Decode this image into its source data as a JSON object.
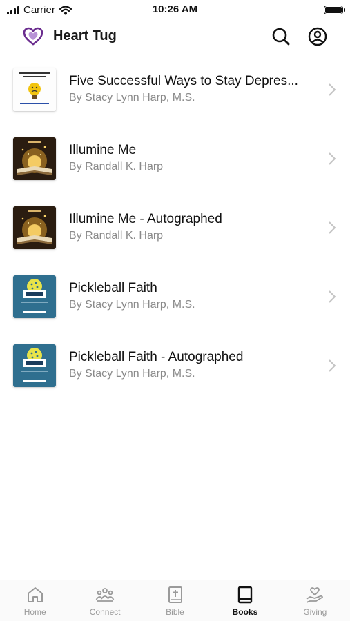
{
  "status_bar": {
    "carrier": "Carrier",
    "time": "10:26 AM"
  },
  "header": {
    "app_title": "Heart Tug",
    "brand_color": "#6b2d8f"
  },
  "books": [
    {
      "title": "Five Successful Ways to Stay Depres...",
      "author": "By Stacy Lynn Harp, M.S.",
      "cover_icon": "emoji-cover"
    },
    {
      "title": "Illumine Me",
      "author": "By Randall K. Harp",
      "cover_icon": "glowing-book-cover"
    },
    {
      "title": "Illumine Me - Autographed",
      "author": "By Randall K. Harp",
      "cover_icon": "glowing-book-cover"
    },
    {
      "title": "Pickleball Faith",
      "author": "By Stacy Lynn Harp, M.S.",
      "cover_icon": "pickleball-cover"
    },
    {
      "title": "Pickleball Faith - Autographed",
      "author": "By Stacy Lynn Harp, M.S.",
      "cover_icon": "pickleball-cover"
    }
  ],
  "tabs": [
    {
      "label": "Home",
      "icon": "home-icon",
      "active": false
    },
    {
      "label": "Connect",
      "icon": "people-icon",
      "active": false
    },
    {
      "label": "Bible",
      "icon": "bible-icon",
      "active": false
    },
    {
      "label": "Books",
      "icon": "book-icon",
      "active": true
    },
    {
      "label": "Giving",
      "icon": "giving-hand-icon",
      "active": false
    }
  ]
}
